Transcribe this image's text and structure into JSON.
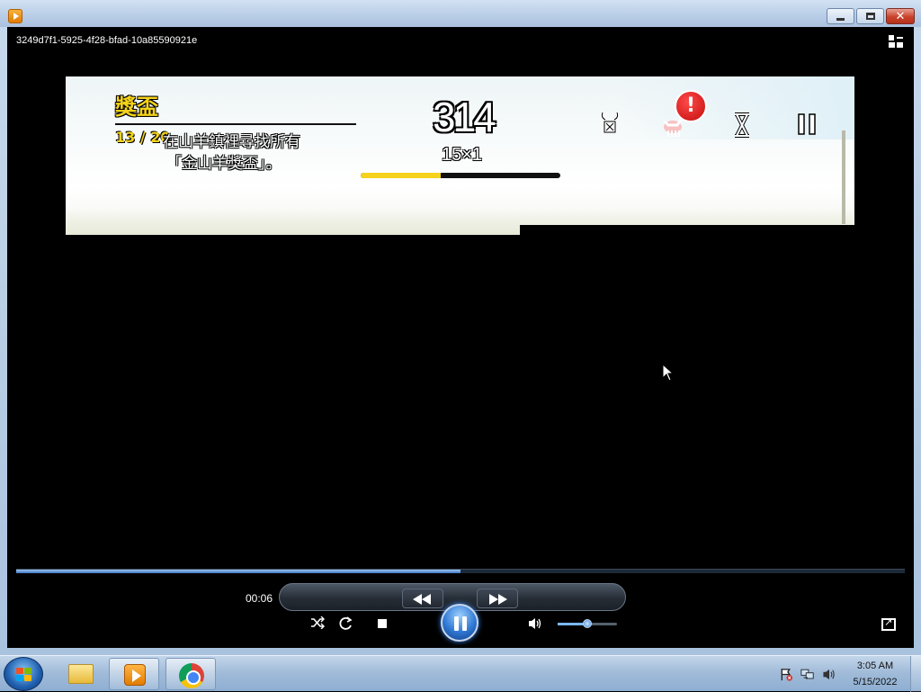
{
  "window": {
    "media_title": "3249d7f1-5925-4f28-bfad-10a85590921e",
    "buttons": {
      "minimize": "minimize",
      "maximize": "maximize",
      "close": "close"
    }
  },
  "video": {
    "hud": {
      "title": "獎盃",
      "progress": "13 / 20",
      "desc_line1": "在山羊鎮裡尋找所有",
      "desc_line2": "「金山羊獎盃」。",
      "score": "314",
      "combo": "15×1",
      "combo_fill_fraction": 0.4,
      "alert_glyph": "!",
      "icons": [
        "goat-horns-icon",
        "goat-alert-icon",
        "hourglass-icon",
        "pause-icon"
      ]
    }
  },
  "player": {
    "seek_progress_fraction": 0.5,
    "elapsed": "00:06",
    "volume_fraction": 0.5,
    "controls": [
      "shuffle-icon",
      "repeat-icon",
      "stop-icon",
      "previous-icon",
      "pause-icon",
      "next-icon",
      "volume-icon"
    ]
  },
  "taskbar": {
    "items": [
      "windows-explorer",
      "windows-media-player",
      "google-chrome"
    ],
    "clock_time": "3:05 AM",
    "clock_date": "5/15/2022"
  },
  "colors": {
    "titlebar": "#bcd0e8",
    "hud_yellow": "#f3d21a",
    "accent_blue": "#2f78d4",
    "close_red": "#c9422b"
  }
}
